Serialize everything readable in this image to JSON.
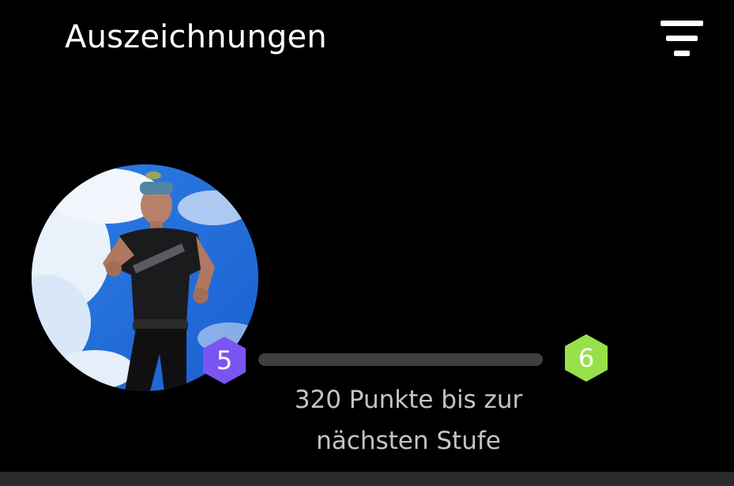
{
  "header": {
    "title": "Auszeichnungen",
    "filter_icon": "filter-list-icon"
  },
  "profile": {
    "avatar_icon": "runner-avatar-photo"
  },
  "level": {
    "current": "5",
    "next": "6",
    "current_color": "#7b55f2",
    "next_color": "#98e04a",
    "progress_fraction": 0,
    "points_line1": "320 Punkte bis zur",
    "points_line2": "nächsten Stufe"
  },
  "colors": {
    "background": "#000000",
    "track": "#3f3f41",
    "subtext": "#c4c4c4"
  }
}
